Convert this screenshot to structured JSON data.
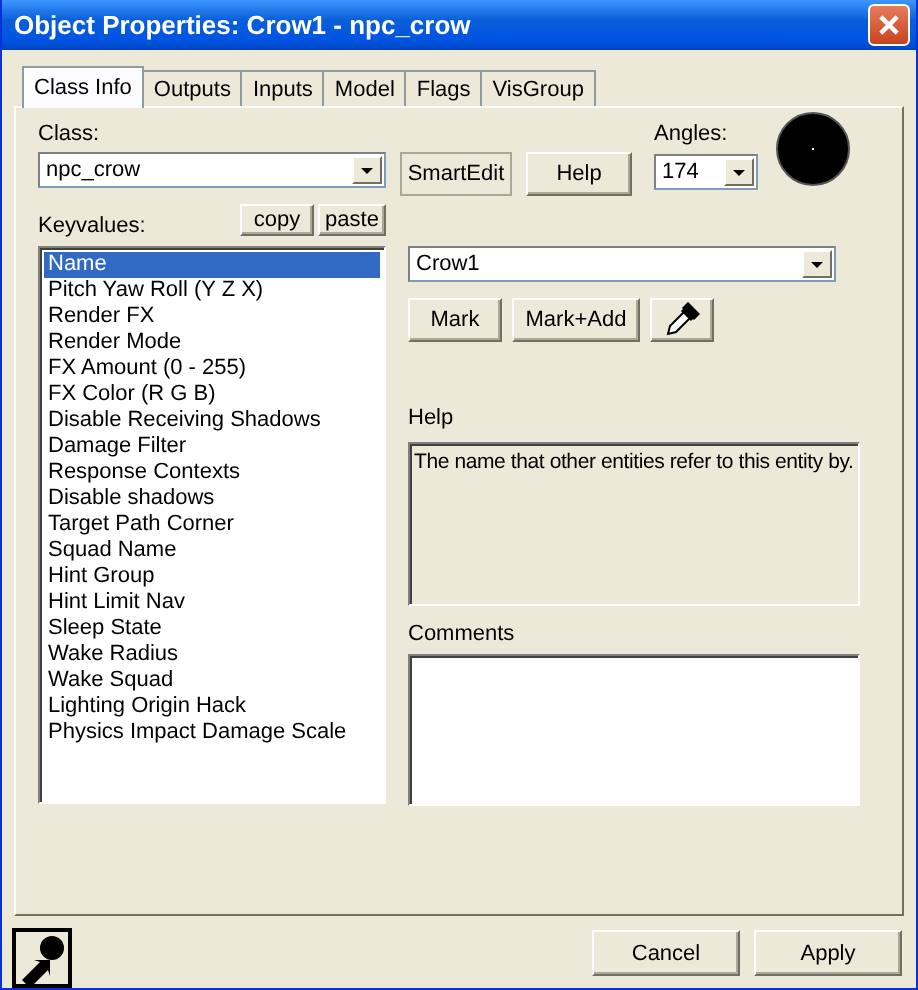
{
  "window": {
    "title": "Object Properties: Crow1 - npc_crow"
  },
  "tabs": [
    {
      "label": "Class Info",
      "selected": true
    },
    {
      "label": "Outputs",
      "selected": false
    },
    {
      "label": "Inputs",
      "selected": false
    },
    {
      "label": "Model",
      "selected": false
    },
    {
      "label": "Flags",
      "selected": false
    },
    {
      "label": "VisGroup",
      "selected": false
    }
  ],
  "class": {
    "label": "Class:",
    "value": "npc_crow"
  },
  "smartedit_button": "SmartEdit",
  "help_button": "Help",
  "angles": {
    "label": "Angles:",
    "value": "174"
  },
  "keyvalues": {
    "label": "Keyvalues:",
    "copy_button": "copy",
    "paste_button": "paste",
    "items": [
      {
        "label": "Name",
        "selected": true
      },
      {
        "label": "Pitch Yaw Roll (Y Z X)",
        "selected": false
      },
      {
        "label": "Render FX",
        "selected": false
      },
      {
        "label": "Render Mode",
        "selected": false
      },
      {
        "label": "FX Amount (0 - 255)",
        "selected": false
      },
      {
        "label": "FX Color (R G B)",
        "selected": false
      },
      {
        "label": "Disable Receiving Shadows",
        "selected": false
      },
      {
        "label": "Damage Filter",
        "selected": false
      },
      {
        "label": "Response Contexts",
        "selected": false
      },
      {
        "label": "Disable shadows",
        "selected": false
      },
      {
        "label": "Target Path Corner",
        "selected": false
      },
      {
        "label": "Squad Name",
        "selected": false
      },
      {
        "label": "Hint Group",
        "selected": false
      },
      {
        "label": "Hint Limit Nav",
        "selected": false
      },
      {
        "label": "Sleep State",
        "selected": false
      },
      {
        "label": "Wake Radius",
        "selected": false
      },
      {
        "label": "Wake Squad",
        "selected": false
      },
      {
        "label": "Lighting Origin Hack",
        "selected": false
      },
      {
        "label": "Physics Impact Damage Scale",
        "selected": false
      }
    ]
  },
  "value_field": "Crow1",
  "mark_button": "Mark",
  "mark_add_button": "Mark+Add",
  "help": {
    "label": "Help",
    "text": "The name that other entities refer to this entity by."
  },
  "comments": {
    "label": "Comments"
  },
  "buttons": [
    "Cancel",
    "Apply"
  ]
}
